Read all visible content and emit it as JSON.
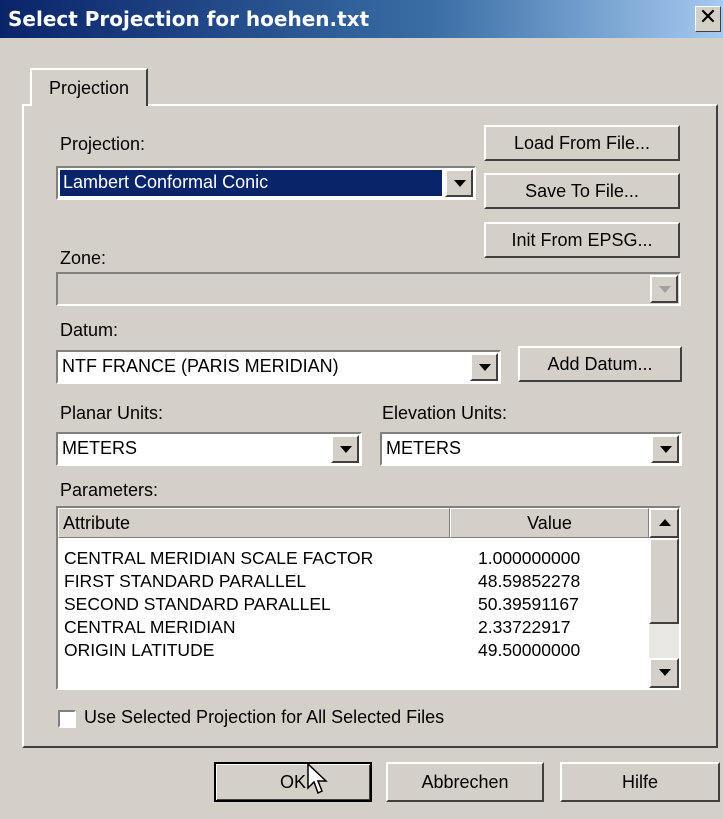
{
  "window": {
    "title": "Select Projection for hoehen.txt",
    "close_glyph": "✕"
  },
  "tabs": [
    {
      "label": "Projection"
    }
  ],
  "projection": {
    "label": "Projection:",
    "value": "Lambert Conformal Conic",
    "load_button": "Load From File...",
    "save_button": "Save To File...",
    "init_button": "Init From EPSG..."
  },
  "zone": {
    "label": "Zone:",
    "value": ""
  },
  "datum": {
    "label": "Datum:",
    "value": "NTF FRANCE (PARIS MERIDIAN)",
    "add_button": "Add Datum..."
  },
  "planar_units": {
    "label": "Planar Units:",
    "value": "METERS"
  },
  "elevation_units": {
    "label": "Elevation Units:",
    "value": "METERS"
  },
  "parameters": {
    "label": "Parameters:",
    "columns": [
      "Attribute",
      "Value"
    ],
    "rows": [
      {
        "attribute": "CENTRAL MERIDIAN SCALE FACTOR",
        "value": "1.000000000"
      },
      {
        "attribute": "FIRST STANDARD PARALLEL",
        "value": "48.59852278"
      },
      {
        "attribute": "SECOND STANDARD PARALLEL",
        "value": "50.39591167"
      },
      {
        "attribute": "CENTRAL MERIDIAN",
        "value": "2.33722917"
      },
      {
        "attribute": "ORIGIN LATITUDE",
        "value": "49.50000000"
      }
    ]
  },
  "use_all_files": {
    "label": "Use Selected Projection for All Selected Files",
    "checked": false
  },
  "footer": {
    "ok": "OK",
    "cancel": "Abbrechen",
    "help": "Hilfe"
  },
  "colors": {
    "face": "#d4d0c8",
    "selection": "#0a246a",
    "title_start": "#0a246a",
    "title_end": "#a6caf0"
  },
  "icons": {
    "close": "close-icon",
    "combo_arrow": "chevron-down-icon",
    "cursor": "mouse-pointer-icon"
  }
}
